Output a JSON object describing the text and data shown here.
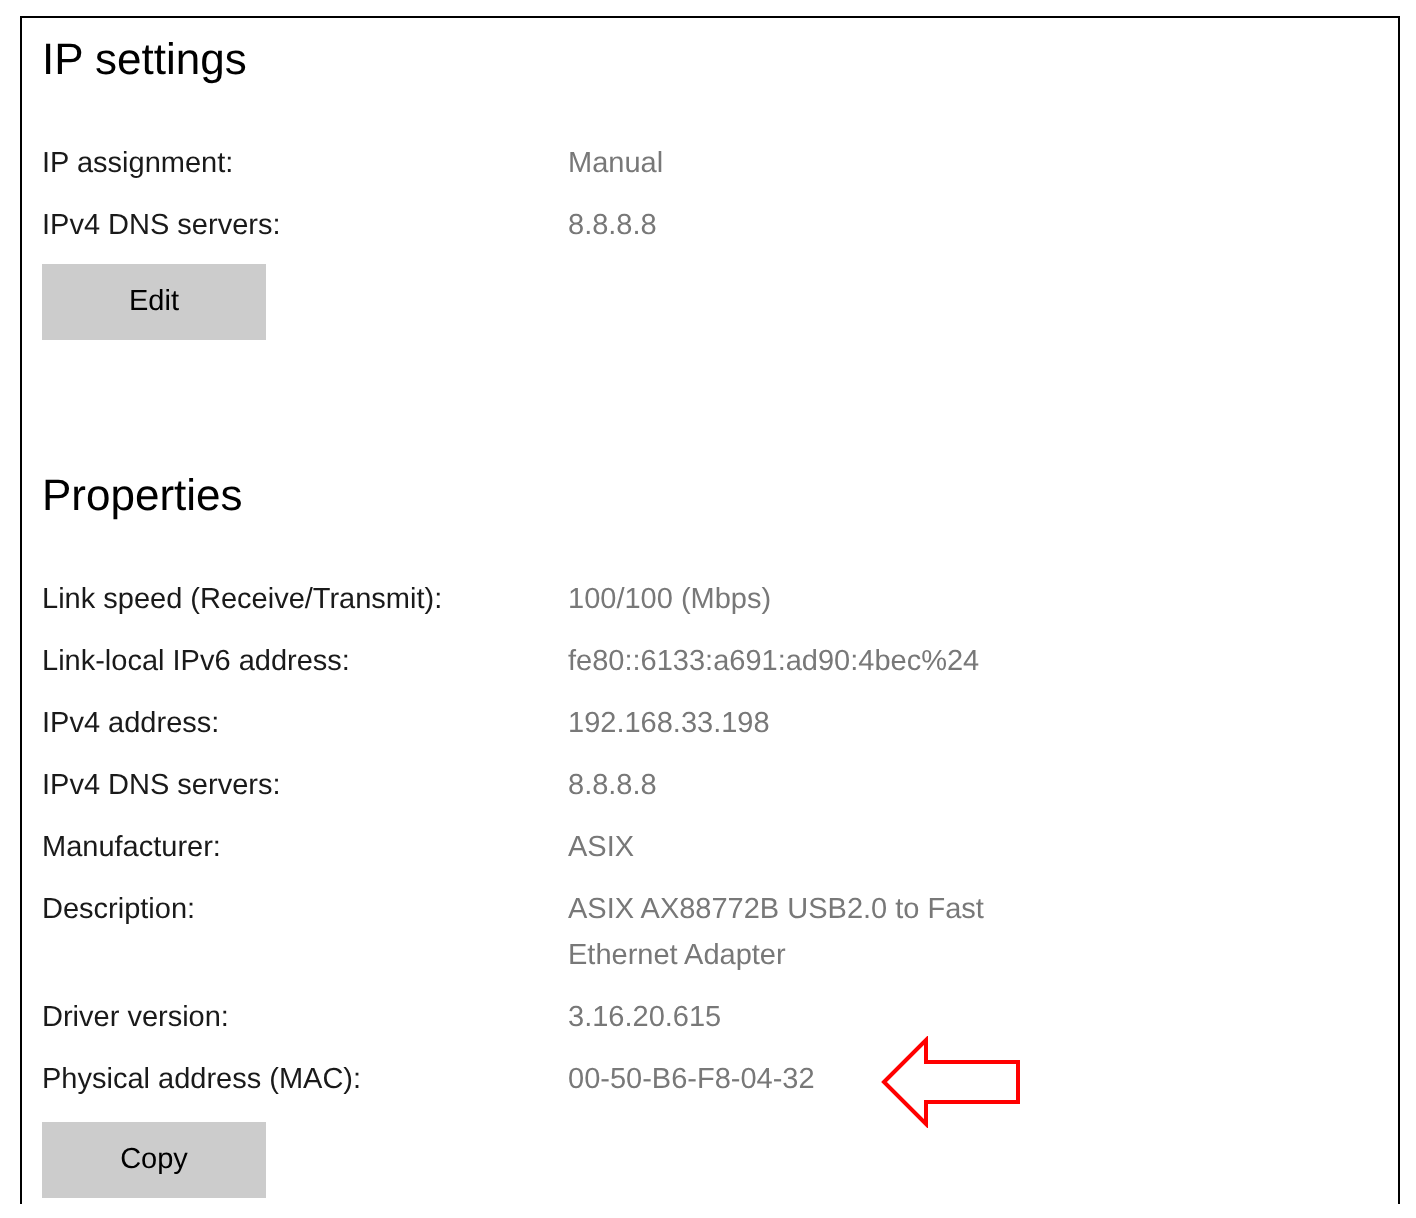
{
  "sections": [
    {
      "title": "IP settings",
      "rows": [
        {
          "label": "IP assignment:",
          "value": "Manual"
        },
        {
          "label": "IPv4 DNS servers:",
          "value": "8.8.8.8"
        }
      ],
      "button": "Edit"
    },
    {
      "title": "Properties",
      "rows": [
        {
          "label": "Link speed (Receive/Transmit):",
          "value": "100/100 (Mbps)"
        },
        {
          "label": "Link-local IPv6 address:",
          "value": "fe80::6133:a691:ad90:4bec%24"
        },
        {
          "label": "IPv4 address:",
          "value": "192.168.33.198"
        },
        {
          "label": "IPv4 DNS servers:",
          "value": "8.8.8.8"
        },
        {
          "label": "Manufacturer:",
          "value": "ASIX"
        },
        {
          "label": "Description:",
          "value": "ASIX AX88772B USB2.0 to Fast Ethernet Adapter"
        },
        {
          "label": "Driver version:",
          "value": "3.16.20.615"
        },
        {
          "label": "Physical address (MAC):",
          "value": "00-50-B6-F8-04-32"
        }
      ],
      "button": "Copy"
    }
  ]
}
